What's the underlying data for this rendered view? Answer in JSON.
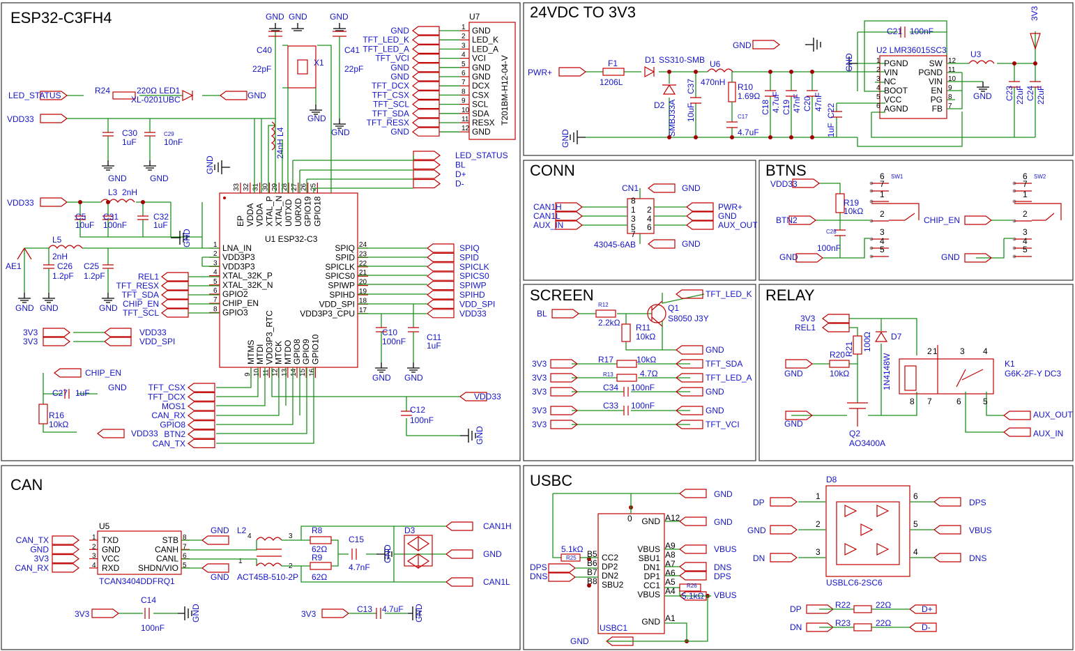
{
  "sections": {
    "esp": "ESP32-C3FH4",
    "power": "24VDC TO 3V3",
    "conn": "CONN",
    "btns": "BTNS",
    "screen": "SCREEN",
    "relay": "RELAY",
    "can": "CAN",
    "usbc": "USBC"
  },
  "esp": {
    "u1_ref": "U1 ESP32-C3",
    "left_pins": [
      {
        "num": "1",
        "name": "LNA_IN"
      },
      {
        "num": "2",
        "name": "VDD3P3"
      },
      {
        "num": "3",
        "name": "VDD3P3"
      },
      {
        "num": "4",
        "name": "XTAL_32K_P"
      },
      {
        "num": "5",
        "name": "XTAL_32K_N"
      },
      {
        "num": "6",
        "name": "GPIO2"
      },
      {
        "num": "7",
        "name": "CHIP_EN"
      },
      {
        "num": "8",
        "name": "GPIO3"
      }
    ],
    "left_nets": [
      "REL1",
      "TFT_RESX",
      "TFT_SDA",
      "CHIP_EN",
      "TFT_SCL"
    ],
    "right_pins": [
      {
        "num": "24",
        "name": "SPIQ",
        "net": "SPIQ"
      },
      {
        "num": "23",
        "name": "SPID",
        "net": "SPID"
      },
      {
        "num": "22",
        "name": "SPICLK",
        "net": "SPICLK"
      },
      {
        "num": "21",
        "name": "SPICS0",
        "net": "SPICS0"
      },
      {
        "num": "20",
        "name": "SPIWP",
        "net": "SPIWP"
      },
      {
        "num": "19",
        "name": "SPIHD",
        "net": "SPIHD"
      },
      {
        "num": "18",
        "name": "VDD_SPI",
        "net": "VDD_SPI"
      },
      {
        "num": "17",
        "name": "VDD3P3_CPU",
        "net": "VDD33"
      }
    ],
    "top_pins": [
      {
        "num": "33",
        "name": "EP"
      },
      {
        "num": "32",
        "name": "VDDA"
      },
      {
        "num": "31",
        "name": "VDDA"
      },
      {
        "num": "30",
        "name": "XTAL_P"
      },
      {
        "num": "29",
        "name": "XTAL_N"
      },
      {
        "num": "28",
        "name": "U0TXD"
      },
      {
        "num": "27",
        "name": "U0RXD"
      },
      {
        "num": "26",
        "name": "GPIO19"
      },
      {
        "num": "25",
        "name": "GPIO18"
      }
    ],
    "top_nets": [
      "LED_STATUS",
      "BL",
      "D+",
      "D-"
    ],
    "bottom_pins": [
      {
        "num": "9",
        "name": "MTMS"
      },
      {
        "num": "10",
        "name": "MTDI"
      },
      {
        "num": "11",
        "name": "VDD3P3_RTC"
      },
      {
        "num": "12",
        "name": "MTCK"
      },
      {
        "num": "13",
        "name": "MTDO"
      },
      {
        "num": "14",
        "name": "GPIO8"
      },
      {
        "num": "15",
        "name": "GPIO9"
      },
      {
        "num": "16",
        "name": "GPIO10"
      }
    ],
    "bottom_nets": [
      "TFT_CSX",
      "TFT_DCX",
      "MOS1",
      "CAN_RX",
      "GPIO8",
      "BTN2",
      "CAN_TX"
    ],
    "u7": {
      "ref": "U7",
      "part": "T201BM-H12-04-V",
      "pins": [
        {
          "num": "1",
          "name": "GND",
          "net": "GND"
        },
        {
          "num": "2",
          "name": "LED_K",
          "net": "TFT_LED_K"
        },
        {
          "num": "3",
          "name": "LED_A",
          "net": "TFT_LED_A"
        },
        {
          "num": "4",
          "name": "VCI",
          "net": "TFT_VCI"
        },
        {
          "num": "5",
          "name": "GND",
          "net": "GND"
        },
        {
          "num": "6",
          "name": "GND",
          "net": "GND"
        },
        {
          "num": "7",
          "name": "DCX",
          "net": "TFT_DCX"
        },
        {
          "num": "8",
          "name": "CSX",
          "net": "TFT_CSX"
        },
        {
          "num": "9",
          "name": "SCL",
          "net": "TFT_SCL"
        },
        {
          "num": "10",
          "name": "SDA",
          "net": "TFT_SDA"
        },
        {
          "num": "11",
          "name": "RESX",
          "net": "TFT_RESX"
        },
        {
          "num": "12",
          "name": "GND",
          "net": "GND"
        }
      ]
    },
    "labels": {
      "vdd33": "VDD33",
      "gnd": "GND",
      "led_status": "LED_STATUS",
      "r24": "R24",
      "led1": "220Ω LED1",
      "led1_pkg": "XL-0201UBC",
      "c30": "C30",
      "c30v": "1uF",
      "c29": "C29",
      "c29v": "10nF",
      "l3": "L3",
      "l3v": "2nH",
      "c5": "C5",
      "c5v": "10uF",
      "c31": "C31",
      "c31v": "100nF",
      "c32": "C32",
      "c32v": "1uF",
      "l5": "L5",
      "l5v": "2nH",
      "ae1": "AE1",
      "c26": "C26",
      "c26v": "1.2pF",
      "c25": "C25",
      "c25v": "1.2pF",
      "c40": "C40",
      "c40v": "22pF",
      "c41": "C41",
      "c41v": "22pF",
      "x1": "X1",
      "l4": "24nH L4",
      "c10": "C10",
      "c10v": "100nF",
      "c11": "C11",
      "c11v": "1uF",
      "c12": "C12",
      "c12v": "100nF",
      "v3v3": "3V3",
      "vdd_spi": "VDD_SPI",
      "chip_en": "CHIP_EN",
      "c27": "C27",
      "c27v": "1uF",
      "r16": "R16",
      "r16v": "10kΩ"
    }
  },
  "power": {
    "labels": {
      "pwr": "PWR+",
      "gnd": "GND",
      "f1": "F1",
      "f1v": "1206L",
      "d1": "D1",
      "d1v": "SS310-SMB",
      "d2": "D2",
      "d2v": "SMBJ33A",
      "c37": "C37",
      "c37v": "10uF",
      "u6": "U6",
      "u6v": "470nH",
      "r10": "R10",
      "r10v": "1.69Ω",
      "c17": "C17",
      "c17v": "4.7uF",
      "c18": "C18",
      "c18v": "4.7uF",
      "c19": "C19",
      "c19v": "47nF",
      "c20": "C20",
      "c20v": "47nF",
      "c22": "C22",
      "c22v": "1uF",
      "c21": "C21",
      "c21v": "100nF",
      "u2": "U2 LMR36015SC3",
      "u3": "U3",
      "v3v3": "3V3",
      "c23": "C23",
      "c23v": "22uF",
      "c24": "C24",
      "c24v": "22uF"
    },
    "u2_left": [
      {
        "num": "1",
        "name": "PGND"
      },
      {
        "num": "2",
        "name": "VIN"
      },
      {
        "num": "3",
        "name": "NC"
      },
      {
        "num": "4",
        "name": "BOOT"
      },
      {
        "num": "5",
        "name": "VCC"
      },
      {
        "num": "6",
        "name": "AGND"
      }
    ],
    "u2_right": [
      {
        "num": "12",
        "name": "SW"
      },
      {
        "num": "11",
        "name": "PGND"
      },
      {
        "num": "10",
        "name": "VIN"
      },
      {
        "num": "9",
        "name": "EN"
      },
      {
        "num": "8",
        "name": "PG"
      },
      {
        "num": "7",
        "name": "FB"
      }
    ]
  },
  "conn": {
    "labels": {
      "cn1": "CN1",
      "part": "43045-6AB",
      "gnd": "GND"
    },
    "left": [
      "CAN1H",
      "CAN1L",
      "AUX_IN"
    ],
    "right": [
      "PWR+",
      "GND",
      "AUX_OUT"
    ],
    "pins": [
      "8",
      "1",
      "2",
      "3",
      "4",
      "5",
      "6",
      "7"
    ]
  },
  "btns": {
    "labels": {
      "vdd33": "VDD33",
      "r19": "R19",
      "r19v": "10kΩ",
      "btn2": "BTN2",
      "c28": "C28",
      "c28v": "100nF",
      "gnd": "GND",
      "sw1": "SW1",
      "sw2": "SW2",
      "chip_en": "CHIP_EN"
    },
    "sw_pins": [
      "6",
      "7",
      "1",
      "2",
      "3",
      "4",
      "5"
    ]
  },
  "screen": {
    "labels": {
      "bl": "BL",
      "r12": "R12",
      "r12v": "2.2kΩ",
      "r11": "R11",
      "r11v": "10kΩ",
      "q1": "Q1",
      "q1v": "S8050 J3Y",
      "tft_led_k": "TFT_LED_K",
      "gnd": "GND",
      "v3v3": "3V3",
      "r17": "R17",
      "r17v": "10kΩ",
      "tft_sda": "TFT_SDA",
      "r13": "R13",
      "r13v": "4.7Ω",
      "tft_led_a": "TFT_LED_A",
      "c34": "C34",
      "c34v": "100nF",
      "c33": "C33",
      "c33v": "100nF",
      "tft_vci": "TFT_VCI"
    }
  },
  "relay": {
    "labels": {
      "v3v3": "3V3",
      "rel1": "REL1",
      "r21": "R21",
      "r21v": "100Ω",
      "d7": "D7",
      "d7v": "1N4148W",
      "r20": "R20",
      "r20v": "10kΩ",
      "gnd": "GND",
      "q2": "Q2",
      "q2v": "AO3400A",
      "k1": "K1",
      "k1v": "G6K-2F-Y DC3",
      "aux_out": "AUX_OUT",
      "aux_in": "AUX_IN"
    },
    "k_pins": [
      "1",
      "2",
      "3",
      "4",
      "8",
      "7",
      "6",
      "5"
    ]
  },
  "can": {
    "labels": {
      "u5": "U5",
      "u5v": "TCAN3404DDFRQ1",
      "l2": "L2",
      "l2v": "ACT45B-510-2P",
      "r8": "R8",
      "r8v": "62Ω",
      "r9": "R9",
      "r9v": "62Ω",
      "c15": "C15",
      "c15v": "4.7nF",
      "d3": "D3",
      "c14": "C14",
      "c14v": "100nF",
      "c13": "C13",
      "c13v": "4.7uF",
      "v3v3": "3V3",
      "gnd": "GND",
      "can1h": "CAN1H",
      "can1l": "CAN1L"
    },
    "u5_left": [
      {
        "num": "1",
        "name": "TXD",
        "net": "CAN_TX"
      },
      {
        "num": "2",
        "name": "GND",
        "net": "GND"
      },
      {
        "num": "3",
        "name": "VCC",
        "net": "3V3"
      },
      {
        "num": "4",
        "name": "RXD",
        "net": "CAN_RX"
      }
    ],
    "u5_right": [
      {
        "num": "8",
        "name": "STB"
      },
      {
        "num": "7",
        "name": "CANH"
      },
      {
        "num": "6",
        "name": "CANL"
      },
      {
        "num": "5",
        "name": "SHDN/VIO"
      }
    ]
  },
  "usbc": {
    "labels": {
      "gnd": "GND",
      "r25": "R25",
      "r25v": "5.1kΩ",
      "dps": "DPS",
      "dns": "DNS",
      "usbc1": "USBC1",
      "r26": "R26",
      "r26v": "5.1kΩ",
      "vbus": "VBUS",
      "d8": "D8",
      "d8v": "USBLC6-2SC6",
      "dp": "DP",
      "dn": "DN",
      "r22": "R22",
      "r22v": "22Ω",
      "r23": "R23",
      "r23v": "22Ω",
      "dplus": "D+",
      "dminus": "D-",
      "zero": "0"
    },
    "left_pins": [
      {
        "num": "B5",
        "name": "CC2"
      },
      {
        "num": "B6",
        "name": "DP2"
      },
      {
        "num": "B7",
        "name": "DN2"
      },
      {
        "num": "B8",
        "name": "SBU2"
      }
    ],
    "right_pins": [
      {
        "num": "A12",
        "name": "GND"
      },
      {
        "num": "A9",
        "name": "VBUS"
      },
      {
        "num": "A8",
        "name": "SBU1"
      },
      {
        "num": "A7",
        "name": "DN1"
      },
      {
        "num": "A6",
        "name": "DP1"
      },
      {
        "num": "A5",
        "name": "CC1"
      },
      {
        "num": "A4",
        "name": "VBUS"
      },
      {
        "num": "A1",
        "name": "GND"
      }
    ],
    "d8_pins": [
      {
        "num": "1",
        "net": "DP"
      },
      {
        "num": "2",
        "net": "GND"
      },
      {
        "num": "3",
        "net": "DN"
      },
      {
        "num": "6",
        "net": "DPS"
      },
      {
        "num": "5",
        "net": "VBUS"
      },
      {
        "num": "4",
        "net": "DNS"
      }
    ]
  }
}
